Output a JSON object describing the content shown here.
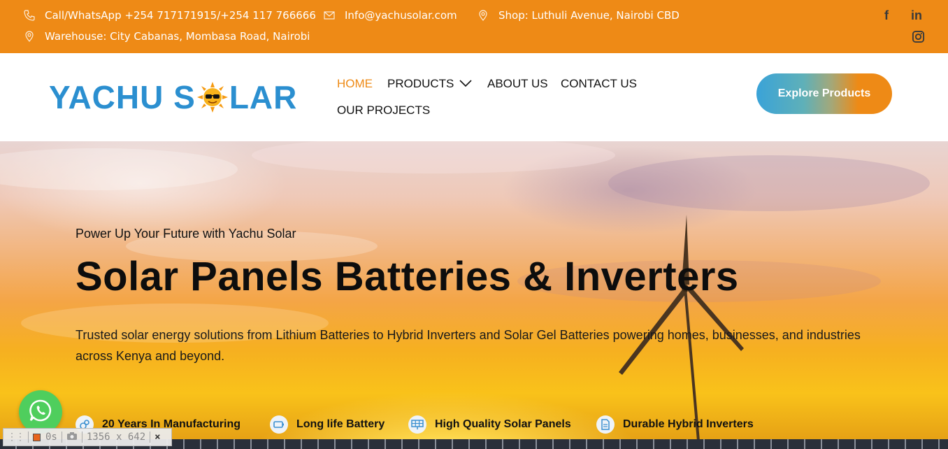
{
  "topbar": {
    "phone": "Call/WhatsApp +254 717171915/+254 117 766666",
    "email": "Info@yachusolar.com",
    "shop": "Shop: Luthuli Avenue, Nairobi CBD",
    "warehouse": "Warehouse: City Cabanas, Mombasa Road, Nairobi",
    "social": {
      "facebook": "f",
      "linkedin": "in"
    }
  },
  "header": {
    "logo": {
      "part1": "YACHU S",
      "part2": "LAR"
    },
    "nav": {
      "home": "HOME",
      "products": "PRODUCTS",
      "about": "ABOUT US",
      "contact": "CONTACT US",
      "projects": "OUR PROJECTS"
    },
    "cta": "Explore Products"
  },
  "hero": {
    "subtitle": "Power Up Your Future with Yachu Solar",
    "title": "Solar Panels Batteries & Inverters",
    "description": "Trusted solar energy solutions from Lithium Batteries to Hybrid Inverters and Solar Gel Batteries powering homes, businesses, and industries across Kenya and beyond.",
    "features": [
      "20 Years In Manufacturing",
      "Long life Battery",
      "High Quality Solar Panels",
      "Durable Hybrid Inverters"
    ]
  },
  "recorder": {
    "time": "0s",
    "size": "1356 x 642",
    "close": "×"
  },
  "colors": {
    "accent": "#ee8a16",
    "logo_blue": "#2b8fd0",
    "whatsapp": "#4fce5d"
  },
  "icons": [
    "phone-icon",
    "email-icon",
    "location-icon",
    "facebook-icon",
    "linkedin-icon",
    "instagram-icon",
    "chevron-down-icon",
    "whatsapp-icon",
    "camera-icon"
  ]
}
